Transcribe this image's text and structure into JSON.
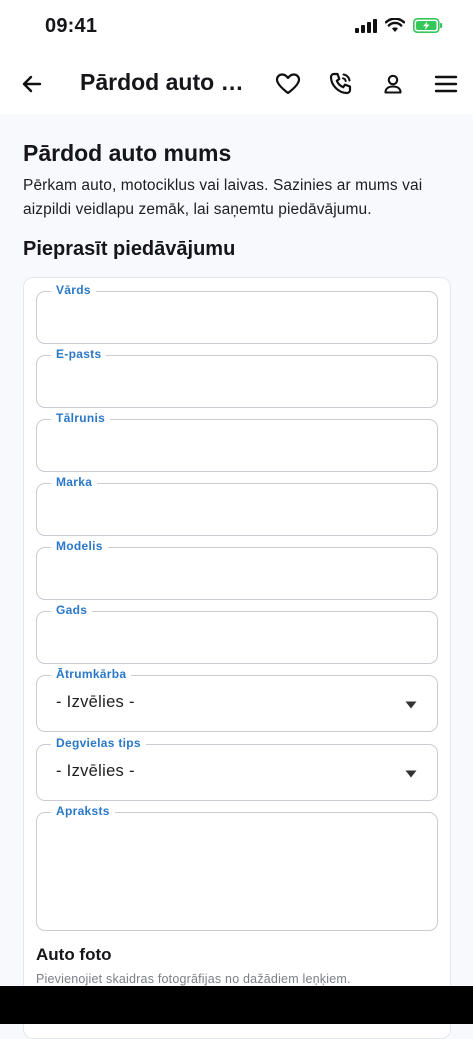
{
  "status_bar": {
    "time": "09:41"
  },
  "header": {
    "title": "Pārdod auto mums"
  },
  "page": {
    "title": "Pārdod auto mums",
    "intro": "Pērkam auto, motociklus vai laivas. Sazinies ar mums vai aizpildi veidlapu zemāk, lai saņemtu piedāvājumu.",
    "section_title": "Pieprasīt piedāvājumu"
  },
  "form": {
    "fields": [
      {
        "label": "Vārds",
        "value": ""
      },
      {
        "label": "E-pasts",
        "value": ""
      },
      {
        "label": "Tālrunis",
        "value": ""
      },
      {
        "label": "Marka",
        "value": ""
      },
      {
        "label": "Modelis",
        "value": ""
      },
      {
        "label": "Gads",
        "value": ""
      }
    ],
    "gearbox": {
      "label": "Ātrumkārba",
      "value": "- Izvēlies -"
    },
    "fuel": {
      "label": "Degvielas tips",
      "value": "- Izvēlies -"
    },
    "description": {
      "label": "Apraksts",
      "value": ""
    },
    "photos": {
      "title": "Auto foto",
      "desc": "Pievienojiet skaidras fotogrāfijas no dažādiem leņķiem."
    }
  },
  "colors": {
    "accent": "#2a78c8",
    "battery": "#34c759"
  },
  "icons": [
    "back-arrow-icon",
    "heart-icon",
    "phone-icon",
    "user-icon",
    "menu-icon",
    "chevron-down-icon"
  ]
}
